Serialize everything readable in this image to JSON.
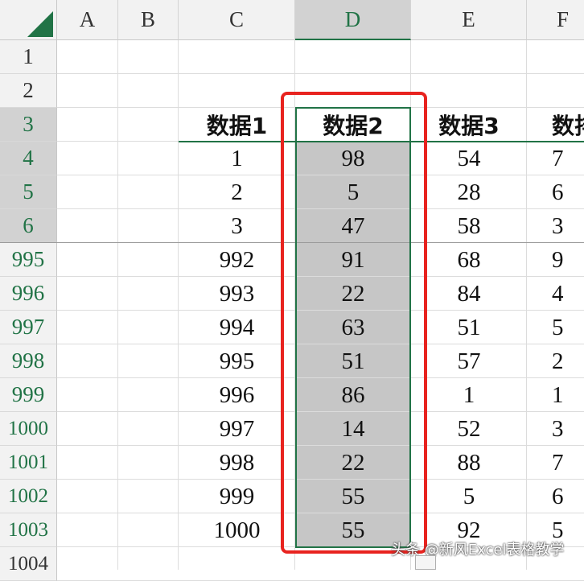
{
  "columns": [
    "A",
    "B",
    "C",
    "D",
    "E",
    "F"
  ],
  "selected_column": "D",
  "rows": [
    {
      "num": "1",
      "c": "",
      "d": "",
      "e": "",
      "f": "",
      "style": "plain"
    },
    {
      "num": "2",
      "c": "",
      "d": "",
      "e": "",
      "f": "",
      "style": "plain"
    },
    {
      "num": "3",
      "c": "数据1",
      "d": "数据2",
      "e": "数据3",
      "f": "数排",
      "style": "hl"
    },
    {
      "num": "4",
      "c": "1",
      "d": "98",
      "e": "54",
      "f": "7",
      "style": "hl"
    },
    {
      "num": "5",
      "c": "2",
      "d": "5",
      "e": "28",
      "f": "6",
      "style": "hl"
    },
    {
      "num": "6",
      "c": "3",
      "d": "47",
      "e": "58",
      "f": "3",
      "style": "hl"
    },
    {
      "num": "995",
      "c": "992",
      "d": "91",
      "e": "68",
      "f": "9",
      "style": "green"
    },
    {
      "num": "996",
      "c": "993",
      "d": "22",
      "e": "84",
      "f": "4",
      "style": "green"
    },
    {
      "num": "997",
      "c": "994",
      "d": "63",
      "e": "51",
      "f": "5",
      "style": "green"
    },
    {
      "num": "998",
      "c": "995",
      "d": "51",
      "e": "57",
      "f": "2",
      "style": "green"
    },
    {
      "num": "999",
      "c": "996",
      "d": "86",
      "e": "1",
      "f": "1",
      "style": "green"
    },
    {
      "num": "1000",
      "c": "997",
      "d": "14",
      "e": "52",
      "f": "3",
      "style": "green"
    },
    {
      "num": "1001",
      "c": "998",
      "d": "22",
      "e": "88",
      "f": "7",
      "style": "green"
    },
    {
      "num": "1002",
      "c": "999",
      "d": "55",
      "e": "5",
      "f": "6",
      "style": "green"
    },
    {
      "num": "1003",
      "c": "1000",
      "d": "55",
      "e": "92",
      "f": "5",
      "style": "green"
    },
    {
      "num": "1004",
      "c": "",
      "d": "",
      "e": "",
      "f": "",
      "style": "plain"
    }
  ],
  "watermark": "头条 @新风Excel表格教学",
  "colors": {
    "accent": "#217346",
    "highlight_box": "#e8231f",
    "selection": "#c6c6c6"
  }
}
